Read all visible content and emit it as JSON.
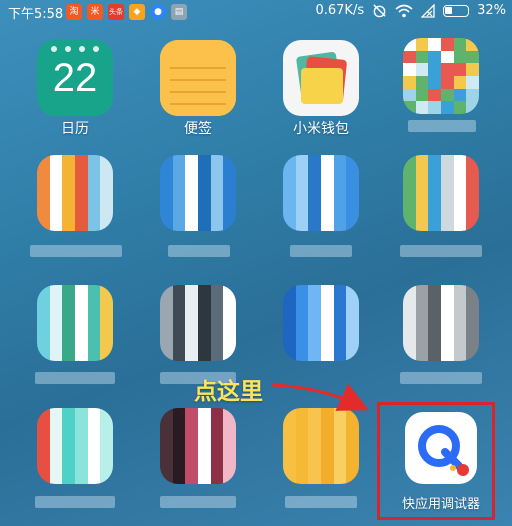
{
  "status_bar": {
    "time": "下午5:58",
    "network_speed": "0.67K/s",
    "battery_percent": "32%",
    "notification_icons": [
      "taobao-icon",
      "mi-icon",
      "toutiao-icon",
      "game-icon",
      "browser-icon",
      "settings-app-icon"
    ]
  },
  "apps": [
    {
      "label": "日历",
      "icon_text": "22",
      "icon": "calendar-icon"
    },
    {
      "label": "便签",
      "icon": "notes-icon"
    },
    {
      "label": "小米钱包",
      "icon": "wallet-icon"
    },
    {
      "label": "快应用调试器",
      "icon": "quick-app-debugger-icon"
    }
  ],
  "annotation": {
    "callout": "点这里",
    "highlight_color": "#d7262b",
    "callout_color": "#ffe35a"
  },
  "colors": {
    "calendar": "#17a48a",
    "notes": "#fcc14a",
    "quick_app_blue": "#2b6cf6",
    "quick_app_red": "#e53935"
  }
}
